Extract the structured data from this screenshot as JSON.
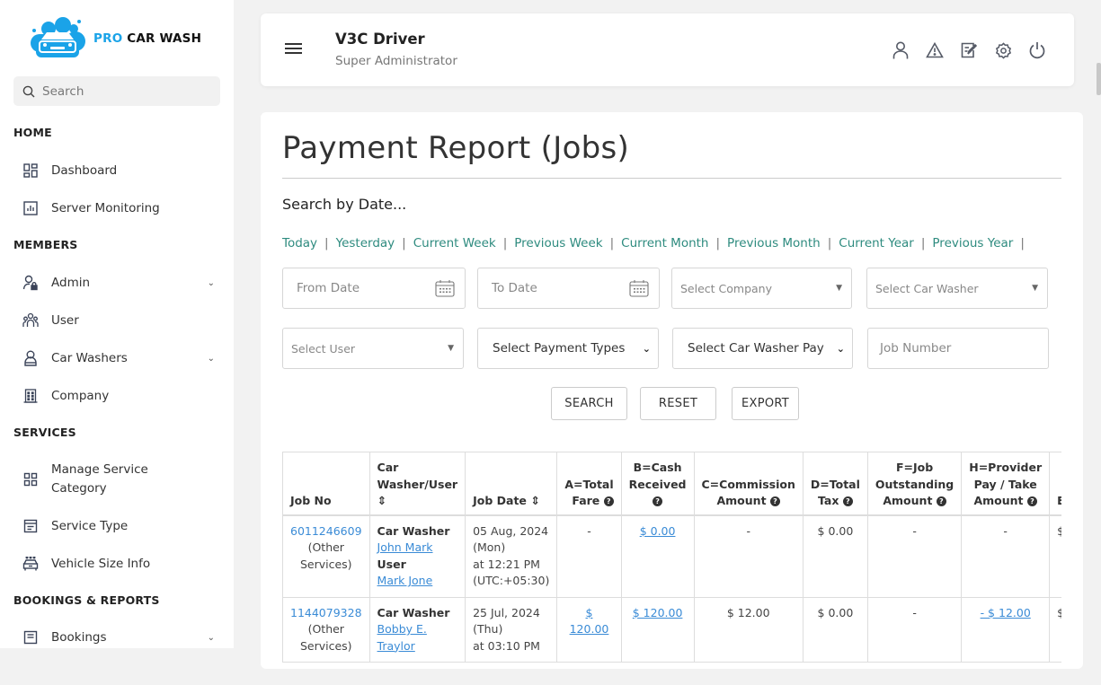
{
  "brand": {
    "pro": "PRO",
    "rest": "CAR WASH"
  },
  "sidebar": {
    "search_placeholder": "Search",
    "sections": {
      "home": "HOME",
      "members": "MEMBERS",
      "services": "SERVICES",
      "bookings": "BOOKINGS & REPORTS"
    },
    "items": {
      "dashboard": "Dashboard",
      "server_monitoring": "Server Monitoring",
      "admin": "Admin",
      "user": "User",
      "car_washers": "Car Washers",
      "company": "Company",
      "manage_service_category_1": "Manage Service",
      "manage_service_category_2": "Category",
      "service_type": "Service Type",
      "vehicle_size_info": "Vehicle Size Info",
      "bookings": "Bookings"
    }
  },
  "header": {
    "user_name": "V3C Driver",
    "user_role": "Super Administrator"
  },
  "page": {
    "title": "Payment Report (Jobs)",
    "search_by_date": "Search by Date...",
    "quick_ranges": [
      "Today",
      "Yesterday",
      "Current Week",
      "Previous Week",
      "Current Month",
      "Previous Month",
      "Current Year",
      "Previous Year"
    ],
    "filters": {
      "from_date": "From Date",
      "to_date": "To Date",
      "company": "Select Company",
      "car_washer": "Select Car Washer",
      "user": "Select User",
      "payment_types": "Select Payment Types",
      "car_washer_pay": "Select Car Washer Pay",
      "job_number": "Job Number"
    },
    "buttons": {
      "search": "SEARCH",
      "reset": "RESET",
      "export": "EXPORT"
    }
  },
  "table": {
    "headers": {
      "job_no": "Job No",
      "car_washer_user_1": "Car",
      "car_washer_user_2": "Washer/User",
      "job_date": "Job Date",
      "total_fare_1": "A=Total",
      "total_fare_2": "Fare",
      "cash_received_1": "B=Cash",
      "cash_received_2": "Received",
      "commission_1": "C=Commission",
      "commission_2": "Amount",
      "total_tax_1": "D=Total",
      "total_tax_2": "Tax",
      "outstanding_1": "F=Job",
      "outstanding_2": "Outstanding",
      "outstanding_3": "Amount",
      "provider_pay_1": "H=Provider",
      "provider_pay_2": "Pay / Take",
      "provider_pay_3": "Amount",
      "next_partial": "Ea"
    },
    "labels": {
      "car_washer": "Car Washer",
      "user": "User",
      "other_1": "(Other",
      "other_2": "Services)"
    },
    "rows": [
      {
        "job_no": "6011246609",
        "car_washer": "John Mark",
        "user": "Mark Jone",
        "date_1": "05 Aug, 2024",
        "date_2": "(Mon)",
        "date_3": "at 12:21 PM",
        "date_4": "(UTC:+05:30)",
        "total_fare": "-",
        "cash_received": "$ 0.00",
        "commission": "-",
        "total_tax": "$ 0.00",
        "outstanding": "-",
        "provider_pay": "-",
        "next_partial": "$"
      },
      {
        "job_no": "1144079328",
        "car_washer_1": "Bobby E.",
        "car_washer_2": "Traylor",
        "date_1": "25 Jul, 2024",
        "date_2": "(Thu)",
        "date_3": "at 03:10 PM",
        "total_fare": "$ 120.00",
        "cash_received": "$ 120.00",
        "commission": "$ 12.00",
        "total_tax": "$ 0.00",
        "outstanding": "-",
        "provider_pay": "- $ 12.00",
        "next_partial": "$"
      }
    ]
  }
}
